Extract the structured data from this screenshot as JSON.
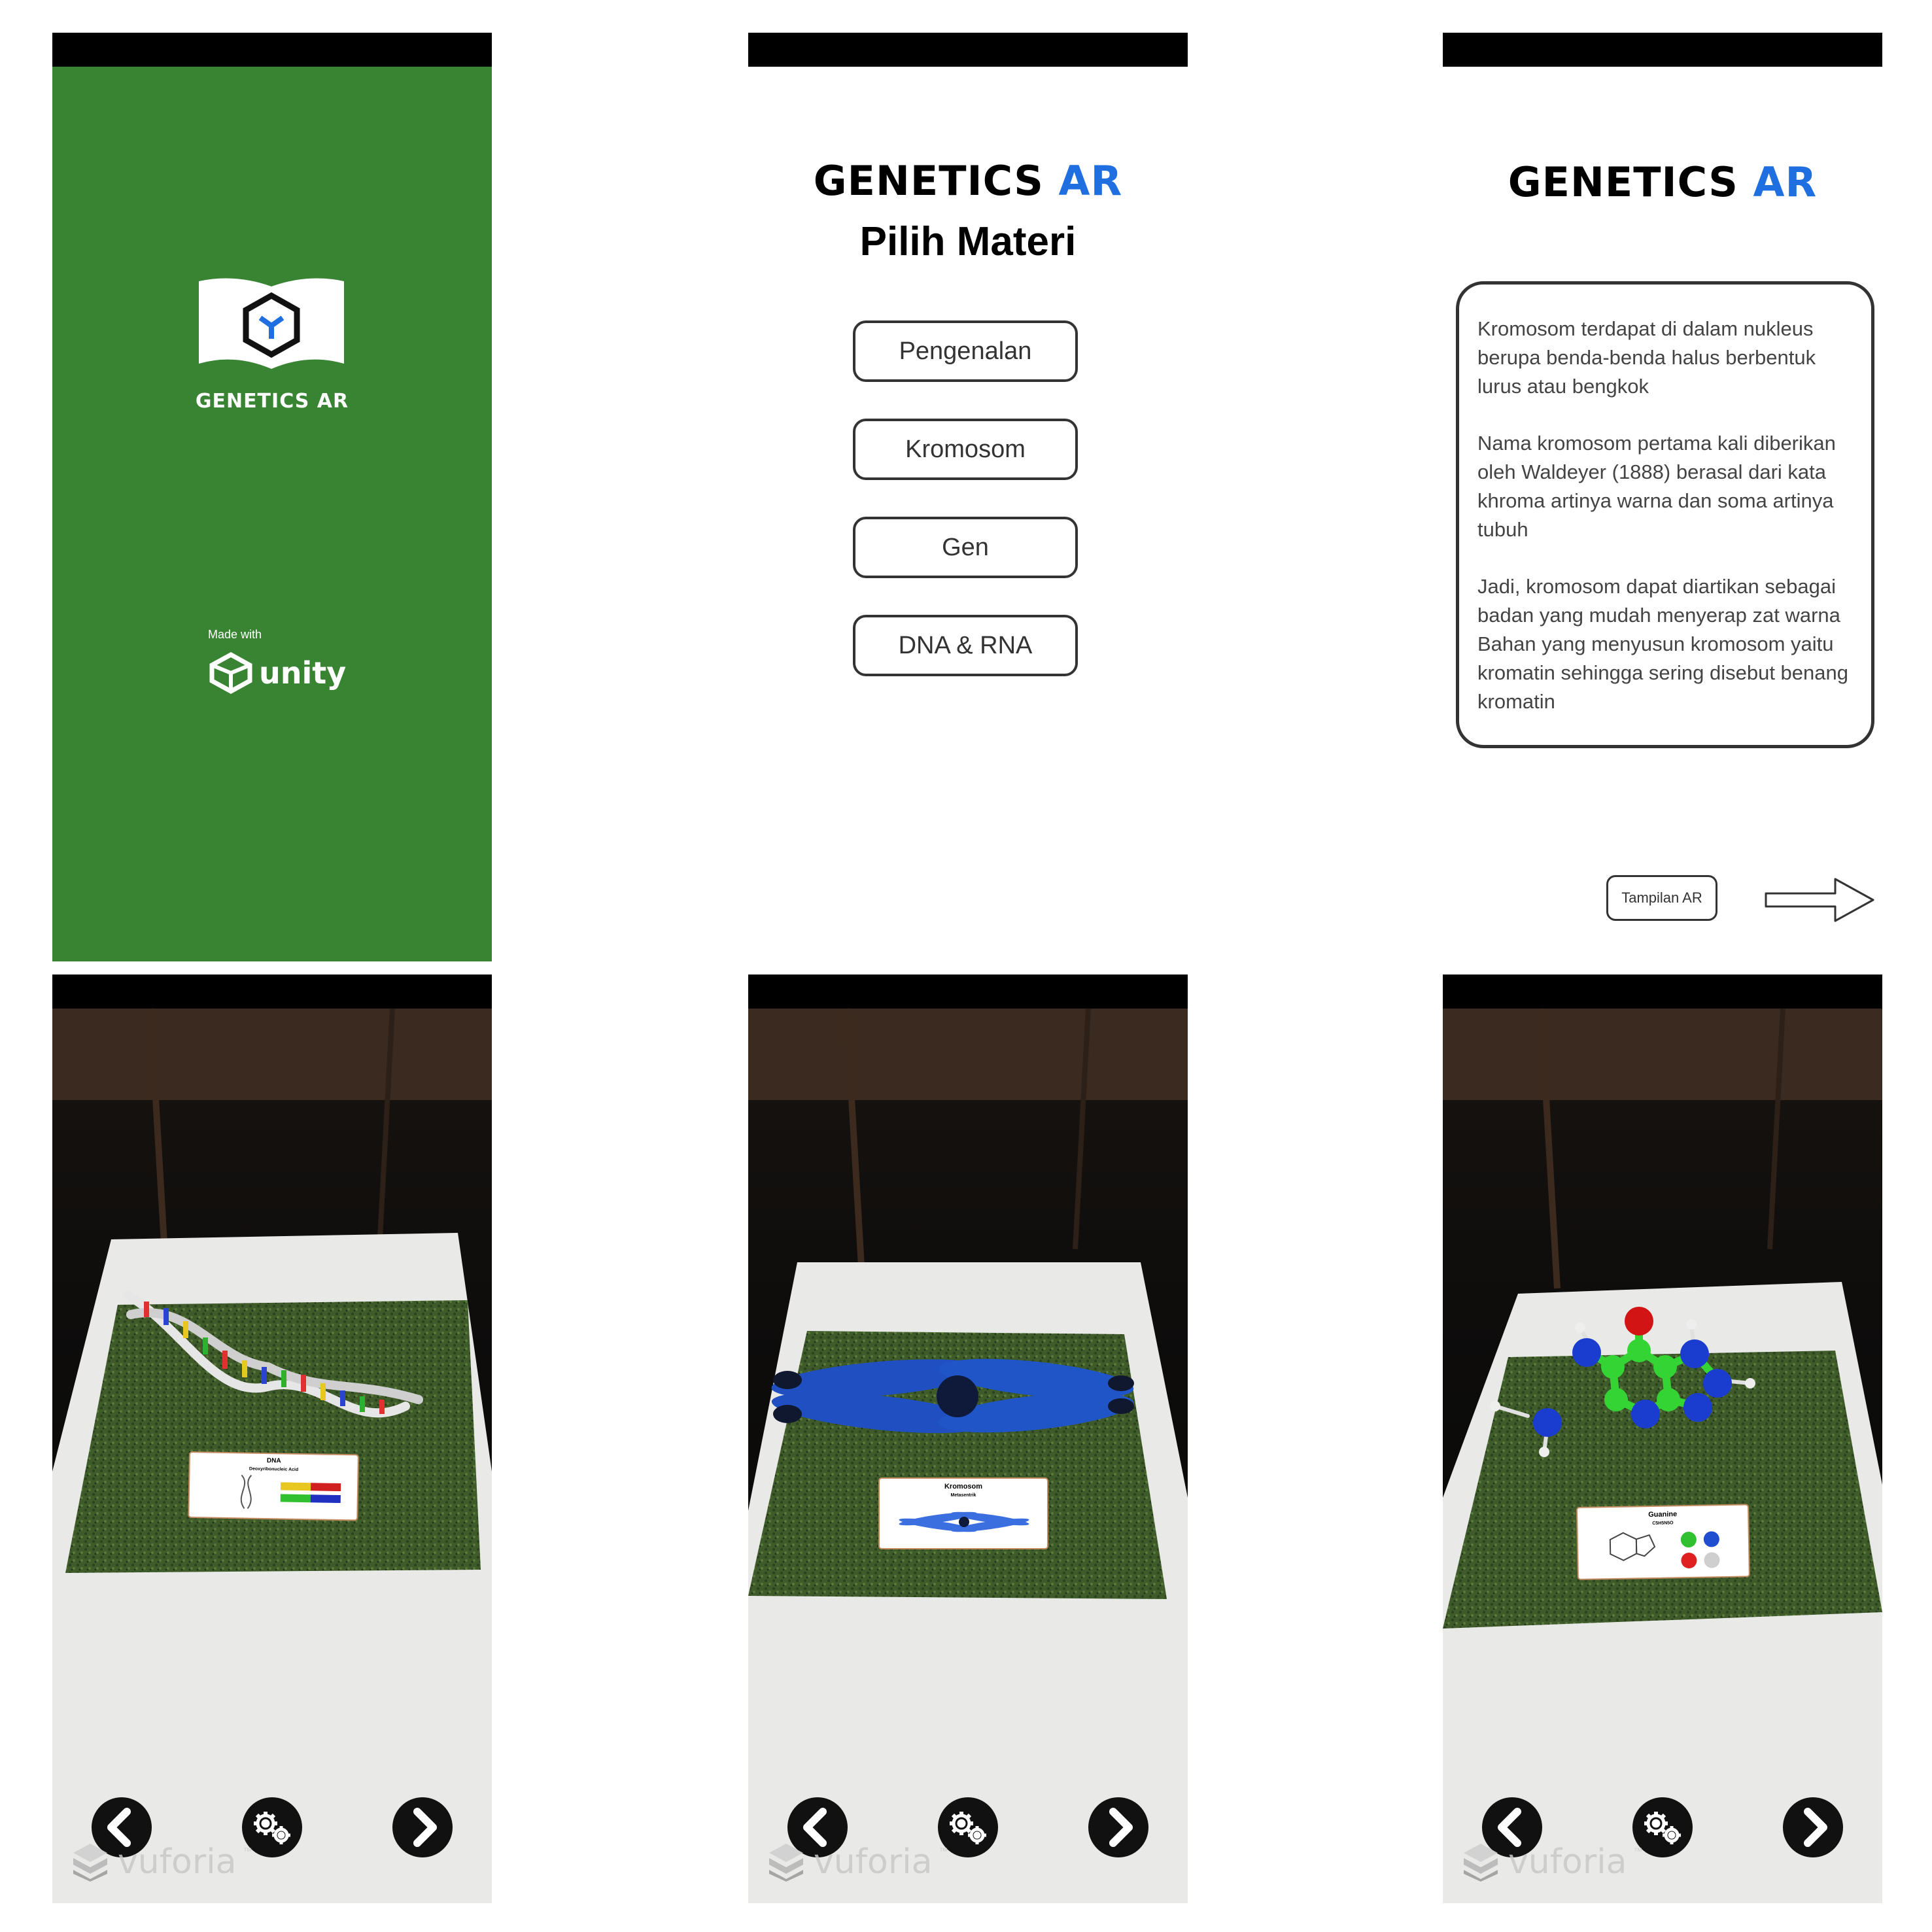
{
  "splash": {
    "app_name": "GENETICS AR",
    "made_with": "Made with",
    "engine": "unity"
  },
  "menu": {
    "title_main": "GENETICS",
    "title_accent": "AR",
    "subtitle": "Pilih Materi",
    "buttons": [
      "Pengenalan",
      "Kromosom",
      "Gen",
      "DNA & RNA"
    ]
  },
  "info": {
    "title_main": "GENETICS",
    "title_accent": "AR",
    "paragraphs": [
      "Kromosom terdapat di dalam nukleus berupa benda-benda halus berbentuk lurus atau bengkok",
      "Nama kromosom pertama kali diberikan oleh Waldeyer (1888) berasal dari kata khroma artinya warna dan soma artinya tubuh",
      "Jadi, kromosom dapat diartikan sebagai badan yang mudah menyerap zat warna Bahan yang menyusun kromosom yaitu kromatin sehingga sering disebut benang kromatin"
    ],
    "ar_button": "Tampilan AR"
  },
  "ar_views": [
    {
      "card_title": "DNA",
      "card_subtitle": "Deoxyribonucleic Acid"
    },
    {
      "card_title": "Kromosom",
      "card_subtitle": "Metasentrik"
    },
    {
      "card_title": "Guanine",
      "card_subtitle": "C5H5N5O"
    }
  ],
  "vuforia": {
    "brand": "vuforia",
    "tm": "™"
  },
  "colors": {
    "splash_green": "#398432",
    "accent_blue": "#1f6fe0",
    "grass": "#3f5b2a",
    "dna_strand": "#e6e6e6",
    "chromosome_blue": "#1f4fc0",
    "molecule_green": "#35d435",
    "molecule_blue": "#1a3ccf",
    "oxygen_red": "#d21414"
  },
  "icons": [
    "cube-logo-icon",
    "unity-logo-icon",
    "arrow-right-icon",
    "chevron-left-icon",
    "chevron-right-icon",
    "gears-icon",
    "vuforia-logo-icon"
  ]
}
